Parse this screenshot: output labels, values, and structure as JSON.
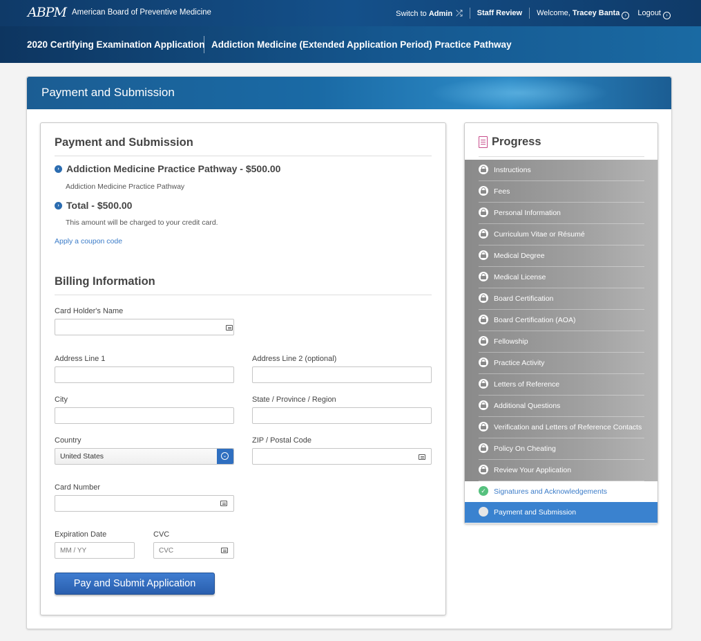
{
  "topbar": {
    "logo": "ABPM",
    "org_name": "American Board of Preventive Medicine",
    "switch_prefix": "Switch to ",
    "switch_target": "Admin",
    "staff_review": "Staff Review",
    "welcome_prefix": "Welcome, ",
    "user_name": "Tracey Banta",
    "logout": "Logout"
  },
  "subheader": {
    "application": "2020 Certifying Examination Application",
    "pathway": "Addiction Medicine (Extended Application Period) Practice Pathway"
  },
  "panel": {
    "title": "Payment and Submission"
  },
  "payment": {
    "title": "Payment and Submission",
    "items": [
      {
        "title": "Addiction Medicine Practice Pathway - $500.00",
        "desc": "Addiction Medicine Practice Pathway"
      },
      {
        "title": "Total - $500.00",
        "desc": "This amount will be charged to your credit card."
      }
    ],
    "coupon_link": "Apply a coupon code"
  },
  "billing": {
    "title": "Billing Information",
    "card_holder_label": "Card Holder's Name",
    "card_holder_value": "",
    "address1_label": "Address Line 1",
    "address1_value": "",
    "address2_label": "Address Line 2 (optional)",
    "address2_value": "",
    "city_label": "City",
    "city_value": "",
    "state_label": "State / Province / Region",
    "state_value": "",
    "country_label": "Country",
    "country_value": "United States",
    "zip_label": "ZIP / Postal Code",
    "zip_value": "",
    "card_number_label": "Card Number",
    "card_number_value": "",
    "expiration_label": "Expiration Date",
    "expiration_placeholder": "MM / YY",
    "cvc_label": "CVC",
    "cvc_placeholder": "CVC",
    "submit_label": "Pay and Submit Application"
  },
  "progress": {
    "title": "Progress",
    "locked_steps": [
      "Instructions",
      "Fees",
      "Personal Information",
      "Curriculum Vitae or Résumé",
      "Medical Degree",
      "Medical License",
      "Board Certification",
      "Board Certification (AOA)",
      "Fellowship",
      "Practice Activity",
      "Letters of Reference",
      "Additional Questions",
      "Verification and Letters of Reference Contacts",
      "Policy On Cheating",
      "Review Your Application"
    ],
    "completed_step": "Signatures and Acknowledgements",
    "current_step": "Payment and Submission"
  },
  "colors": {
    "brand_dark": "#0f3a68",
    "accent_blue": "#3a82cf",
    "link_blue": "#3a7bc8",
    "success_green": "#56c17e"
  }
}
